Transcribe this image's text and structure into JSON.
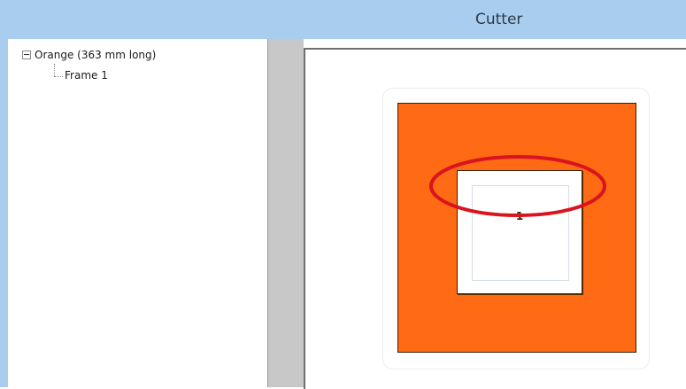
{
  "window": {
    "title": "Cutter"
  },
  "tree": {
    "root_label": "Orange (363 mm long)",
    "children": [
      {
        "label": "Frame 1"
      }
    ]
  },
  "preview": {
    "mat_color": "#ff6a14",
    "opening_number": "1",
    "highlight_color": "#d9141e"
  }
}
